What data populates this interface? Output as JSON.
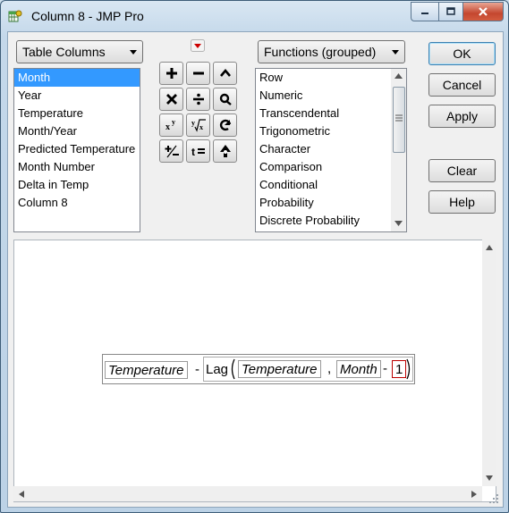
{
  "window": {
    "title": "Column 8 - JMP Pro"
  },
  "columns_selector": {
    "label": "Table Columns",
    "items": [
      "Month",
      "Year",
      "Temperature",
      "Month/Year",
      "Predicted Temperature",
      "Month Number",
      "Delta in Temp",
      "Column 8"
    ],
    "selected": "Month"
  },
  "functions_selector": {
    "label": "Functions (grouped)",
    "items": [
      "Row",
      "Numeric",
      "Transcendental",
      "Trigonometric",
      "Character",
      "Comparison",
      "Conditional",
      "Probability",
      "Discrete Probability"
    ]
  },
  "buttons": {
    "ok": "OK",
    "cancel": "Cancel",
    "apply": "Apply",
    "clear": "Clear",
    "help": "Help"
  },
  "operators": [
    {
      "name": "add",
      "glyph": "+"
    },
    {
      "name": "subtract",
      "glyph": "−"
    },
    {
      "name": "power-up",
      "glyph": "^"
    },
    {
      "name": "multiply",
      "glyph": "×"
    },
    {
      "name": "divide",
      "glyph": "÷"
    },
    {
      "name": "peel",
      "glyph": "ϙ"
    },
    {
      "name": "raise-power",
      "glyph": "xʸ"
    },
    {
      "name": "root",
      "glyph": "ʸ√x"
    },
    {
      "name": "swap",
      "glyph": "⟲"
    },
    {
      "name": "unary-minus",
      "glyph": "+/−"
    },
    {
      "name": "assign",
      "glyph": "t="
    },
    {
      "name": "local",
      "glyph": "♠"
    }
  ],
  "formula": {
    "term1": "Temperature",
    "op1": "-",
    "func": "Lag",
    "arg1": "Temperature",
    "sep": ",",
    "arg2": "Month",
    "op2": "-",
    "num": "1"
  },
  "colors": {
    "selection": "#3399ff",
    "close_button": "#c4472f",
    "accent_red": "#cc0000"
  }
}
